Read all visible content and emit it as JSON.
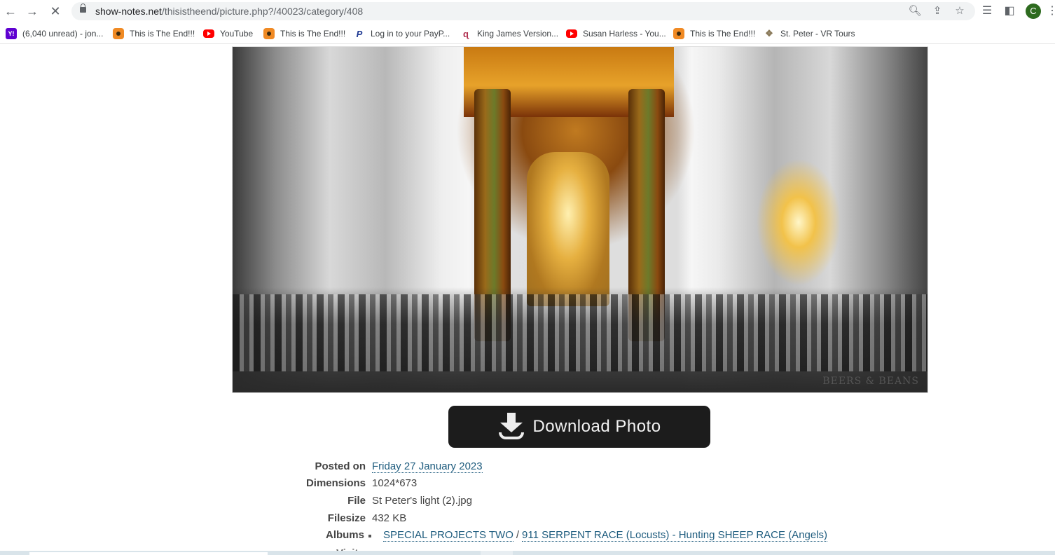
{
  "browser": {
    "url_host": "show-notes.net",
    "url_path": "/thisistheend/picture.php?/40023/category/408",
    "back_icon": "arrow-left-icon",
    "forward_icon": "arrow-right-icon",
    "stop_icon": "close-icon",
    "back_glyph": "←",
    "forward_glyph": "→",
    "stop_glyph": "✕",
    "zoom_glyph": "🔍︎",
    "share_glyph": "⇪",
    "star_glyph": "☆",
    "media_glyph": "☰",
    "sidepanel_glyph": "◧",
    "menu_glyph": "⋮",
    "avatar_letter": "C",
    "avatar_color": "#2e6b1f"
  },
  "bookmarks": [
    {
      "label": "(6,040 unread) - jon...",
      "icon": "yahoo-mail-icon",
      "glyph": "Y!"
    },
    {
      "label": "This is The End!!!",
      "icon": "camera-icon",
      "glyph": ""
    },
    {
      "label": "YouTube",
      "icon": "youtube-icon",
      "glyph": ""
    },
    {
      "label": "This is The End!!!",
      "icon": "camera-icon",
      "glyph": ""
    },
    {
      "label": "Log in to your PayP...",
      "icon": "paypal-icon",
      "glyph": "P"
    },
    {
      "label": "King James Version...",
      "icon": "kjv-icon",
      "glyph": "ɋ"
    },
    {
      "label": "Susan Harless - You...",
      "icon": "youtube-icon",
      "glyph": ""
    },
    {
      "label": "This is The End!!!",
      "icon": "camera-icon",
      "glyph": ""
    },
    {
      "label": "St. Peter - VR Tours",
      "icon": "vr-tours-icon",
      "glyph": "❖"
    }
  ],
  "photo": {
    "alt": "St Peter's light (2).jpg",
    "watermark": "BEERS & BEANS"
  },
  "download_button": {
    "label": "Download Photo"
  },
  "details": {
    "posted_on": {
      "label": "Posted on",
      "value": "Friday 27 January 2023"
    },
    "dimensions": {
      "label": "Dimensions",
      "value": "1024*673"
    },
    "file": {
      "label": "File",
      "value": "St Peter's light (2).jpg"
    },
    "filesize": {
      "label": "Filesize",
      "value": "432 KB"
    },
    "albums": {
      "label": "Albums",
      "parent": "SPECIAL PROJECTS TWO",
      "separator": "/",
      "child": "911 SERPENT RACE (Locusts) - Hunting SHEEP RACE (Angels)"
    },
    "visits": {
      "label": "Visits"
    }
  }
}
